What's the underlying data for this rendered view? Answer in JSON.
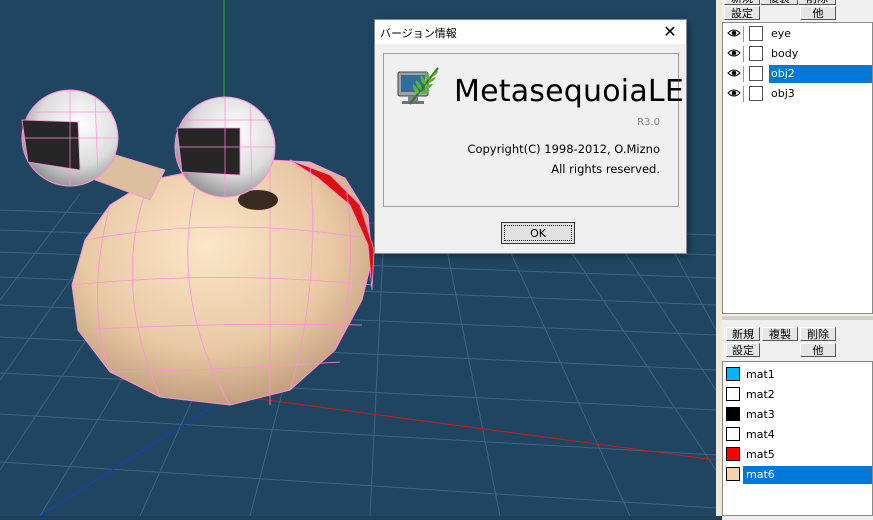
{
  "dialog": {
    "title": "バージョン情報",
    "close_glyph": "✕",
    "app_name": "MetasequoiaLE",
    "version": "R3.0",
    "copyright": "Copyright(C) 1998-2012, O.Mizno",
    "rights": "All rights reserved.",
    "ok_label": "OK"
  },
  "object_panel": {
    "buttons_top": [
      "新規",
      "複製",
      "削除"
    ],
    "buttons_bottom": [
      "設定",
      "他"
    ],
    "objects": [
      {
        "name": "eye",
        "selected": false
      },
      {
        "name": "body",
        "selected": false
      },
      {
        "name": "obj2",
        "selected": true
      },
      {
        "name": "obj3",
        "selected": false
      }
    ]
  },
  "material_panel": {
    "buttons_top": [
      "新規",
      "複製",
      "削除"
    ],
    "buttons_bottom": [
      "設定",
      "他"
    ],
    "materials": [
      {
        "name": "mat1",
        "color": "#00b4ff",
        "selected": false
      },
      {
        "name": "mat2",
        "color": "#ffffff",
        "selected": false
      },
      {
        "name": "mat3",
        "color": "#000000",
        "selected": false
      },
      {
        "name": "mat4",
        "color": "#ffffff",
        "selected": false
      },
      {
        "name": "mat5",
        "color": "#ff0000",
        "selected": false
      },
      {
        "name": "mat6",
        "color": "#f5d3a8",
        "selected": true
      }
    ]
  },
  "icons": {
    "visibility": "eye-icon",
    "lock": "lock-box-icon",
    "app": "fern-monitor-icon"
  },
  "colors": {
    "viewport_bg": "#1f4561",
    "selection": "#0078d7"
  }
}
